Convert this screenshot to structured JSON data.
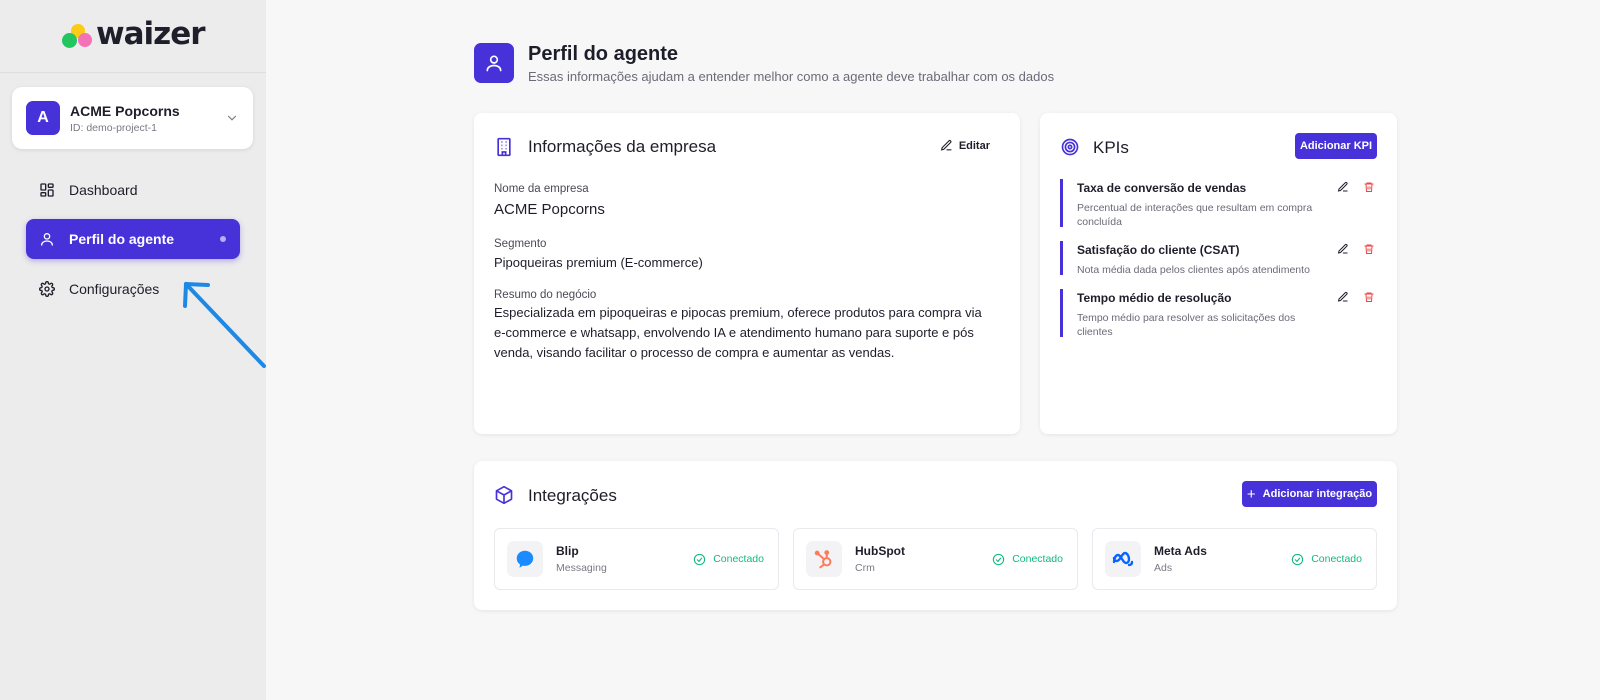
{
  "brand": {
    "name": "waizer"
  },
  "project": {
    "avatar_letter": "A",
    "name": "ACME Popcorns",
    "id_text": "ID: demo-project-1"
  },
  "sidebar": {
    "items": [
      {
        "label": "Dashboard",
        "icon": "dashboard-icon",
        "active": false
      },
      {
        "label": "Perfil do agente",
        "icon": "user-icon",
        "active": true
      },
      {
        "label": "Configurações",
        "icon": "gear-icon",
        "active": false
      }
    ]
  },
  "header": {
    "title": "Perfil do agente",
    "subtitle": "Essas informações ajudam a entender melhor como a agente deve trabalhar com os dados"
  },
  "company": {
    "title": "Informações da empresa",
    "edit_label": "Editar",
    "name_label": "Nome da empresa",
    "name_value": "ACME Popcorns",
    "segment_label": "Segmento",
    "segment_value": "Pipoqueiras premium (E-commerce)",
    "summary_label": "Resumo do negócio",
    "summary_value": "Especializada em pipoqueiras e pipocas premium, oferece produtos para compra via e-commerce e whatsapp, envolvendo IA e atendimento humano para suporte e pós venda, visando facilitar o processo de compra e aumentar as vendas."
  },
  "kpis": {
    "title": "KPIs",
    "add_label": "Adicionar KPI",
    "items": [
      {
        "name": "Taxa de conversão de vendas",
        "description": "Percentual de interações que resultam em compra concluída"
      },
      {
        "name": "Satisfação do cliente (CSAT)",
        "description": "Nota média dada pelos clientes após atendimento"
      },
      {
        "name": "Tempo médio de resolução",
        "description": "Tempo médio para resolver as solicitações dos clientes"
      }
    ]
  },
  "integrations": {
    "title": "Integrações",
    "add_label": "Adicionar integração",
    "items": [
      {
        "name": "Blip",
        "type": "Messaging",
        "status": "Conectado",
        "icon": "blip-logo-icon"
      },
      {
        "name": "HubSpot",
        "type": "Crm",
        "status": "Conectado",
        "icon": "hubspot-logo-icon"
      },
      {
        "name": "Meta Ads",
        "type": "Ads",
        "status": "Conectado",
        "icon": "meta-logo-icon"
      }
    ]
  },
  "colors": {
    "accent": "#4632d8",
    "success": "#10b981",
    "danger": "#ef4444",
    "annotation_arrow": "#1e88e5"
  }
}
